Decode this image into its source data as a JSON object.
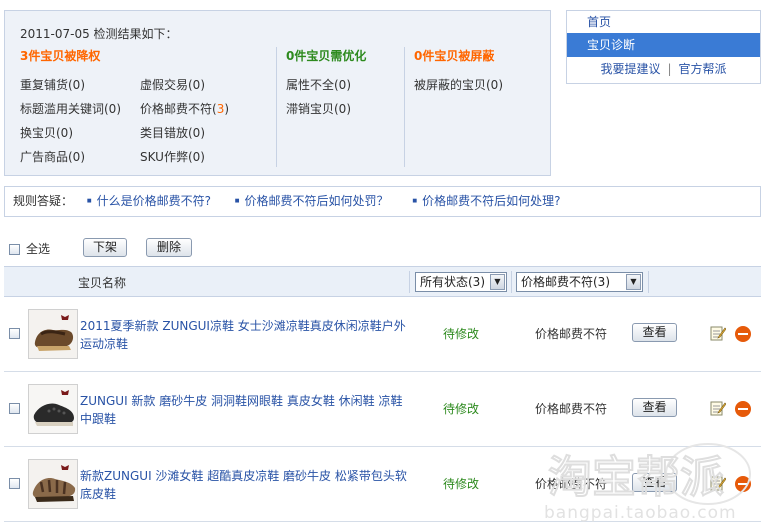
{
  "summary": {
    "date_line": "2011-07-05 检测结果如下：",
    "groups": [
      {
        "title": "3件宝贝被降权",
        "items": [
          {
            "label": "重复铺货(0)"
          },
          {
            "label": "虚假交易(0)"
          },
          {
            "label": "标题滥用关键词(0)"
          },
          {
            "label_prefix": "价格邮费不符(",
            "count": "3",
            "label_suffix": ")"
          },
          {
            "label": "换宝贝(0)"
          },
          {
            "label": "类目错放(0)"
          },
          {
            "label": "广告商品(0)"
          },
          {
            "label": "SKU作弊(0)"
          }
        ]
      },
      {
        "title": "0件宝贝需优化",
        "items": [
          {
            "label": "属性不全(0)"
          },
          {
            "label": "滞销宝贝(0)"
          }
        ]
      },
      {
        "title": "0件宝贝被屏蔽",
        "items": [
          {
            "label": "被屏蔽的宝贝(0)"
          }
        ]
      }
    ],
    "colors": {
      "demoted": "#ff6600",
      "optimize": "#2d8a1e",
      "blocked": "#ff6600"
    }
  },
  "right_nav": {
    "home": "首页",
    "active": "宝贝诊断",
    "suggest": "我要提建议",
    "separator": "|",
    "official_help": "官方帮派",
    "active_color": "#3a7bd5"
  },
  "rules_qa": {
    "label": "规则答疑：",
    "questions": [
      "什么是价格邮费不符?",
      "价格邮费不符后如何处罚？",
      "价格邮费不符后如何处理?"
    ]
  },
  "actions": {
    "select_all": "全选",
    "delist": "下架",
    "delete": "删除"
  },
  "table": {
    "col_name": "宝贝名称",
    "status_filter": "所有状态(3)",
    "reason_filter": "价格邮费不符(3)",
    "rows": [
      {
        "title": "2011夏季新款 ZUNGUI凉鞋 女士沙滩凉鞋真皮休闲凉鞋户外运动凉鞋",
        "status": "待修改",
        "reason": "价格邮费不符",
        "view": "查看"
      },
      {
        "title": "ZUNGUI 新款 磨砂牛皮 洞洞鞋网眼鞋 真皮女鞋 休闲鞋 凉鞋中跟鞋",
        "status": "待修改",
        "reason": "价格邮费不符",
        "view": "查看"
      },
      {
        "title": "新款ZUNGUI 沙滩女鞋 超酷真皮凉鞋 磨砂牛皮 松紧带包头软底皮鞋",
        "status": "待修改",
        "reason": "价格邮费不符",
        "view": "查看"
      }
    ]
  },
  "watermark": {
    "text": "淘宝帮派",
    "url": "bangpai.taobao.com"
  }
}
